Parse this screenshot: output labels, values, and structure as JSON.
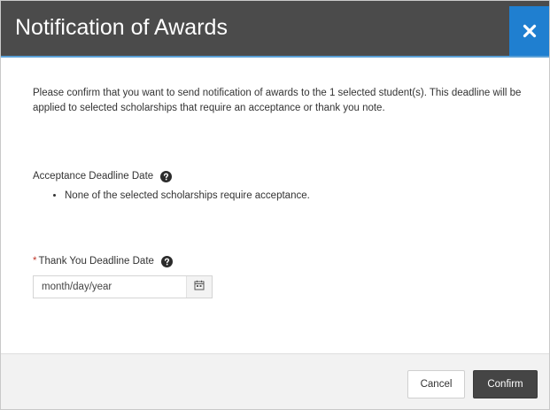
{
  "dialog": {
    "title": "Notification of Awards",
    "close_label": "×"
  },
  "body": {
    "intro_text": "Please confirm that you want to send notification of awards to the 1 selected student(s). This deadline will be applied to selected scholarships that require an acceptance or thank you note.",
    "acceptance": {
      "label": "Acceptance Deadline Date",
      "help_icon": "question-circle-icon",
      "notes": [
        "None of the selected scholarships require acceptance."
      ]
    },
    "thank_you": {
      "required_marker": "*",
      "label": "Thank You Deadline Date",
      "help_icon": "question-circle-icon",
      "date_placeholder": "month/day/year",
      "date_value": "",
      "calendar_icon": "calendar-icon"
    }
  },
  "footer": {
    "cancel_label": "Cancel",
    "confirm_label": "Confirm"
  },
  "colors": {
    "header_bg": "#4b4b4b",
    "close_bg": "#1f7fd0",
    "accent_line": "#5aa0d6",
    "confirm_bg": "#454545",
    "required": "#c0392b"
  }
}
